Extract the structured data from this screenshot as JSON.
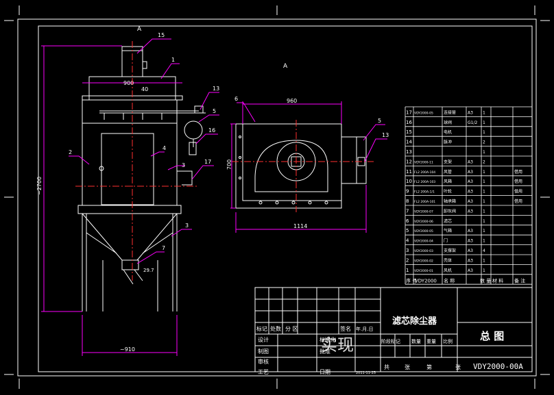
{
  "colors": {
    "background": "#000000",
    "frame": "#ffffff",
    "outline": "#ffffff",
    "dimension": "#ff00ff",
    "centerline": "#ff3030",
    "hidden": "#cfcf30",
    "table_line": "#ffffff"
  },
  "views": {
    "section_mark_front": "A",
    "section_mark_side": "A"
  },
  "dimensions": {
    "total_height": "~2700",
    "top_width": "900",
    "inlet_offset": "40",
    "base_width": "~910",
    "side_width": "960",
    "side_height": "700",
    "side_total_width": "1114",
    "inlet_angle": "29.7"
  },
  "balloons": {
    "b15": "15",
    "b1": "1",
    "b13a": "13",
    "b5a": "5",
    "b16": "16",
    "b2": "2",
    "b4": "4",
    "b3a": "3",
    "b17": "17",
    "b3b": "3",
    "b7": "7",
    "b6": "6",
    "b5b": "5",
    "b13b": "13"
  },
  "parts_list": {
    "rows": [
      {
        "no": "17",
        "code": "VDY2000-05",
        "name": "连接管",
        "material": "A3",
        "qty": "1",
        "note": ""
      },
      {
        "no": "16",
        "code": "",
        "name": "球阀",
        "material": "G1/2",
        "qty": "1",
        "note": ""
      },
      {
        "no": "15",
        "code": "",
        "name": "电机",
        "material": "",
        "qty": "1",
        "note": ""
      },
      {
        "no": "14",
        "code": "",
        "name": "脉冲",
        "material": "",
        "qty": "2",
        "note": ""
      },
      {
        "no": "13",
        "code": "",
        "name": "",
        "material": "",
        "qty": "1",
        "note": ""
      },
      {
        "no": "12",
        "code": "VDY2000-11",
        "name": "支架",
        "material": "A3",
        "qty": "2",
        "note": ""
      },
      {
        "no": "11",
        "code": "FL2 200A-104",
        "name": "风管",
        "material": "A3",
        "qty": "1",
        "note": "借用"
      },
      {
        "no": "10",
        "code": "FL2 200A-103",
        "name": "风箱",
        "material": "A3",
        "qty": "1",
        "note": "借用"
      },
      {
        "no": "9",
        "code": "FL2 200A-1/1",
        "name": "叶轮",
        "material": "A3",
        "qty": "1",
        "note": "借用"
      },
      {
        "no": "8",
        "code": "FL2 200A-101",
        "name": "轴承箱",
        "material": "A3",
        "qty": "1",
        "note": "借用"
      },
      {
        "no": "7",
        "code": "VDY2000-07",
        "name": "卸灰阀",
        "material": "A3",
        "qty": "1",
        "note": ""
      },
      {
        "no": "6",
        "code": "VDY2000-06",
        "name": "滤芯",
        "material": "",
        "qty": "1",
        "note": ""
      },
      {
        "no": "5",
        "code": "VDY2000-05",
        "name": "气箱",
        "material": "A3",
        "qty": "1",
        "note": ""
      },
      {
        "no": "4",
        "code": "VDY2000-04",
        "name": "门",
        "material": "A3",
        "qty": "1",
        "note": ""
      },
      {
        "no": "3",
        "code": "VDY2000-03",
        "name": "支撑架",
        "material": "A3",
        "qty": "4",
        "note": ""
      },
      {
        "no": "2",
        "code": "VDY2000-02",
        "name": "壳体",
        "material": "A3",
        "qty": "1",
        "note": ""
      },
      {
        "no": "1",
        "code": "VDY2000-01",
        "name": "风机",
        "material": "A3",
        "qty": "1",
        "note": ""
      }
    ],
    "header": {
      "no": "序 号",
      "code": "VDY2000",
      "name": "名 称",
      "qty": "数 量",
      "material": "材 料",
      "note": "备 注"
    }
  },
  "title_block": {
    "product_name": "滤芯除尘器",
    "drawing_title": "总 图",
    "drawing_number": "VDY2000-00A",
    "row_labels": {
      "mark": "标记",
      "count": "处数",
      "zone": "分 区",
      "design": "设计",
      "draw": "制图",
      "review": "审核",
      "process": "工艺"
    },
    "sign_labels": {
      "sign_date": "签名",
      "year_month": "年.月.日",
      "standardize": "标准化",
      "approve": "批准",
      "date": "日期"
    },
    "stage_labels": {
      "stage_mark": "阶段标记",
      "weight": "重量",
      "quantity": "数量",
      "scale": "比例"
    },
    "sheet_labels": {
      "total": "共",
      "sheets": "张",
      "sheet_no": "第",
      "page": "张"
    },
    "date_value": "2011-11-25",
    "stamp_text": "实现"
  }
}
